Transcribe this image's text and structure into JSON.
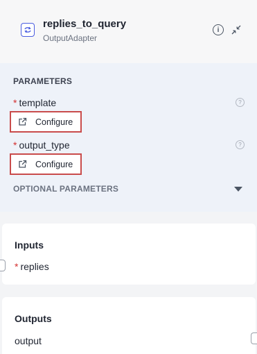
{
  "node": {
    "title": "replies_to_query",
    "subtitle": "OutputAdapter",
    "info_icon": "info-icon",
    "collapse_icon": "collapse-arrows-icon",
    "node_icon": "adapter-cycle-icon"
  },
  "parameters": {
    "heading": "PARAMETERS",
    "items": [
      {
        "name": "template",
        "required": "*",
        "button_label": "Configure",
        "help_icon": "help-icon"
      },
      {
        "name": "output_type",
        "required": "*",
        "button_label": "Configure",
        "help_icon": "help-icon"
      }
    ],
    "optional_heading": "OPTIONAL PARAMETERS"
  },
  "inputs": {
    "heading": "Inputs",
    "items": [
      {
        "name": "replies",
        "required": "*"
      }
    ]
  },
  "outputs": {
    "heading": "Outputs",
    "items": [
      {
        "name": "output"
      }
    ]
  },
  "colors": {
    "accent": "#4a5de0",
    "required": "#d32f2f",
    "highlight_border": "#c94b4b"
  }
}
